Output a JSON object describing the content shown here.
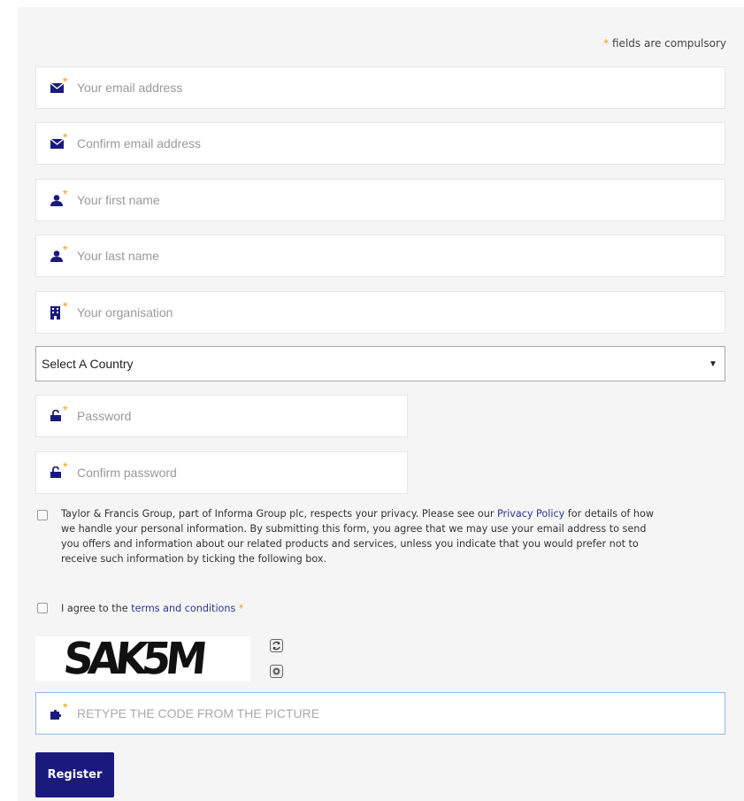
{
  "notice": {
    "star": "*",
    "text": "fields are compulsory"
  },
  "required_star": "*",
  "fields": {
    "email": {
      "placeholder": "Your email address",
      "icon": "envelope-icon"
    },
    "confirm_email": {
      "placeholder": "Confirm email address",
      "icon": "envelope-icon"
    },
    "first_name": {
      "placeholder": "Your first name",
      "icon": "user-icon"
    },
    "last_name": {
      "placeholder": "Your last name",
      "icon": "user-icon"
    },
    "organisation": {
      "placeholder": "Your organisation",
      "icon": "building-icon"
    },
    "password": {
      "placeholder": "Password",
      "icon": "unlock-icon"
    },
    "confirm_password": {
      "placeholder": "Confirm password",
      "icon": "unlock-icon"
    },
    "captcha_code": {
      "placeholder": "RETYPE THE CODE FROM THE PICTURE",
      "icon": "puzzle-icon"
    }
  },
  "country": {
    "selected": "Select A Country",
    "arrow": "▼"
  },
  "privacy": {
    "text_before": "Taylor & Francis Group, part of Informa Group plc, respects your privacy. Please see our ",
    "link": "Privacy Policy",
    "text_after": " for details of how we handle your personal information. By submitting this form, you agree that we may use your email address to send you offers and information about our related products and services, unless you indicate that you would prefer not to receive such information by ticking the following box.",
    "checked": false
  },
  "terms": {
    "text_before": "I agree to the ",
    "link": "terms and conditions",
    "star": "*",
    "checked": false
  },
  "captcha": {
    "text": "SAK5M",
    "refresh_icon": "refresh-icon",
    "audio_icon": "audio-icon"
  },
  "register": {
    "label": "Register"
  },
  "colors": {
    "accent": "#f39c12",
    "link": "#2b3990",
    "button": "#1a1a7e",
    "panel": "#f5f5f5"
  }
}
